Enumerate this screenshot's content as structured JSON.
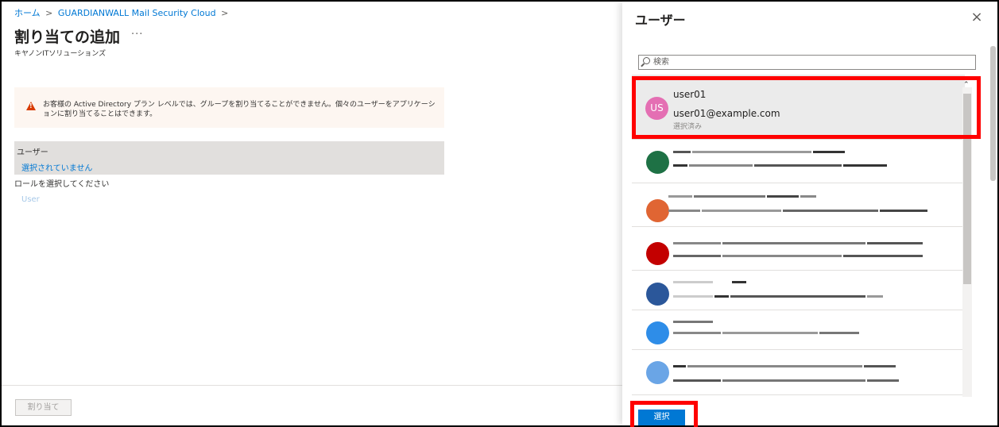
{
  "breadcrumb": {
    "home": "ホーム",
    "separator": ">",
    "app": "GUARDIANWALL Mail Security Cloud"
  },
  "page": {
    "title": "割り当ての追加",
    "more": "···",
    "subtitle": "キヤノンITソリューションズ"
  },
  "warning": {
    "text": "お客様の Active Directory プラン レベルでは、グループを割り当てることができません。個々のユーザーをアプリケーションに割り当てることはできます。"
  },
  "assignment": {
    "user_label": "ユーザー",
    "user_value": "選択されていません",
    "role_label": "ロールを選択してください",
    "role_value": "User"
  },
  "footer": {
    "assign_label": "割り当て"
  },
  "panel": {
    "title": "ユーザー",
    "close": "×",
    "search_placeholder": "検索",
    "select_label": "選択",
    "selected_user": {
      "initials": "US",
      "name": "user01",
      "email": "user01@example.com",
      "status": "選択済み"
    },
    "redacted_users": [
      {
        "avatar_color": "#1e7145"
      },
      {
        "avatar_color": "#e06533"
      },
      {
        "avatar_color": "#c30000"
      },
      {
        "avatar_color": "#2b579a"
      },
      {
        "avatar_color": "#2e8de8"
      },
      {
        "avatar_color": "#6aa5e6"
      }
    ]
  },
  "colors": {
    "accent": "#0078d4",
    "highlight": "#ff0000",
    "selected_avatar": "#e46fb3",
    "warning_icon": "#d83b01"
  }
}
